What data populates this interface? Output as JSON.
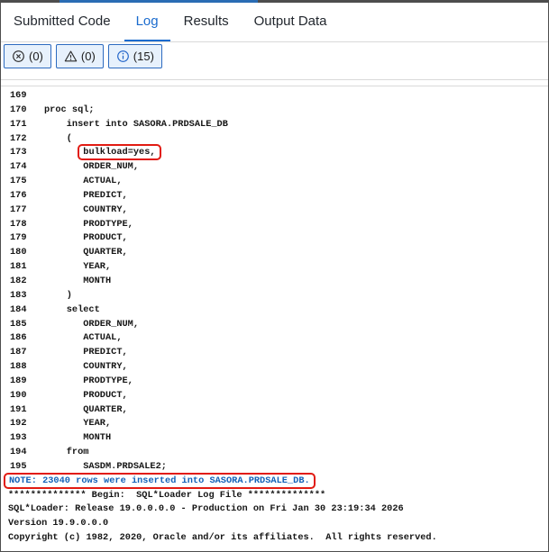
{
  "tabs": [
    {
      "label": "Submitted Code",
      "active": false
    },
    {
      "label": "Log",
      "active": true
    },
    {
      "label": "Results",
      "active": false
    },
    {
      "label": "Output Data",
      "active": false
    }
  ],
  "toolbar": {
    "buttons": [
      {
        "icon": "error-circle-icon",
        "label": "(0)"
      },
      {
        "icon": "warning-triangle-icon",
        "label": "(0)"
      },
      {
        "icon": "info-circle-icon",
        "label": "(15)"
      }
    ]
  },
  "colors": {
    "accent_blue": "#1a6bce",
    "note_blue": "#1261b8",
    "highlight_red": "#e11b12",
    "badge_bg": "#e7f1fc",
    "badge_border": "#2d6bc0",
    "top_strip_blue": "#2a6cb4"
  },
  "log": {
    "numbered_lines": [
      {
        "n": "169",
        "t": ""
      },
      {
        "n": "170",
        "t": "proc sql;"
      },
      {
        "n": "171",
        "t": "    insert into SASORA.PRDSALE_DB"
      },
      {
        "n": "172",
        "t": "    ("
      },
      {
        "n": "173",
        "t": "       ",
        "hl": "bulkload=yes,"
      },
      {
        "n": "174",
        "t": "       ORDER_NUM,"
      },
      {
        "n": "175",
        "t": "       ACTUAL,"
      },
      {
        "n": "176",
        "t": "       PREDICT,"
      },
      {
        "n": "177",
        "t": "       COUNTRY,"
      },
      {
        "n": "178",
        "t": "       PRODTYPE,"
      },
      {
        "n": "179",
        "t": "       PRODUCT,"
      },
      {
        "n": "180",
        "t": "       QUARTER,"
      },
      {
        "n": "181",
        "t": "       YEAR,"
      },
      {
        "n": "182",
        "t": "       MONTH"
      },
      {
        "n": "183",
        "t": "    )"
      },
      {
        "n": "184",
        "t": "    select"
      },
      {
        "n": "185",
        "t": "       ORDER_NUM,"
      },
      {
        "n": "186",
        "t": "       ACTUAL,"
      },
      {
        "n": "187",
        "t": "       PREDICT,"
      },
      {
        "n": "188",
        "t": "       COUNTRY,"
      },
      {
        "n": "189",
        "t": "       PRODTYPE,"
      },
      {
        "n": "190",
        "t": "       PRODUCT,"
      },
      {
        "n": "191",
        "t": "       QUARTER,"
      },
      {
        "n": "192",
        "t": "       YEAR,"
      },
      {
        "n": "193",
        "t": "       MONTH"
      },
      {
        "n": "194",
        "t": "    from"
      },
      {
        "n": "195",
        "t": "       SASDM.PRDSALE2;"
      }
    ],
    "output_lines": [
      {
        "t": "NOTE: 23040 rows were inserted into SASORA.PRDSALE_DB.",
        "style": "note",
        "boxed": true
      },
      {
        "t": "************** Begin:  SQL*Loader Log File **************"
      },
      {
        "t": "SQL*Loader: Release 19.0.0.0.0 - Production on Fri Jan 30 23:19:34 2026"
      },
      {
        "t": "Version 19.9.0.0.0"
      },
      {
        "t": "Copyright (c) 1982, 2020, Oracle and/or its affiliates.  All rights reserved."
      }
    ]
  }
}
